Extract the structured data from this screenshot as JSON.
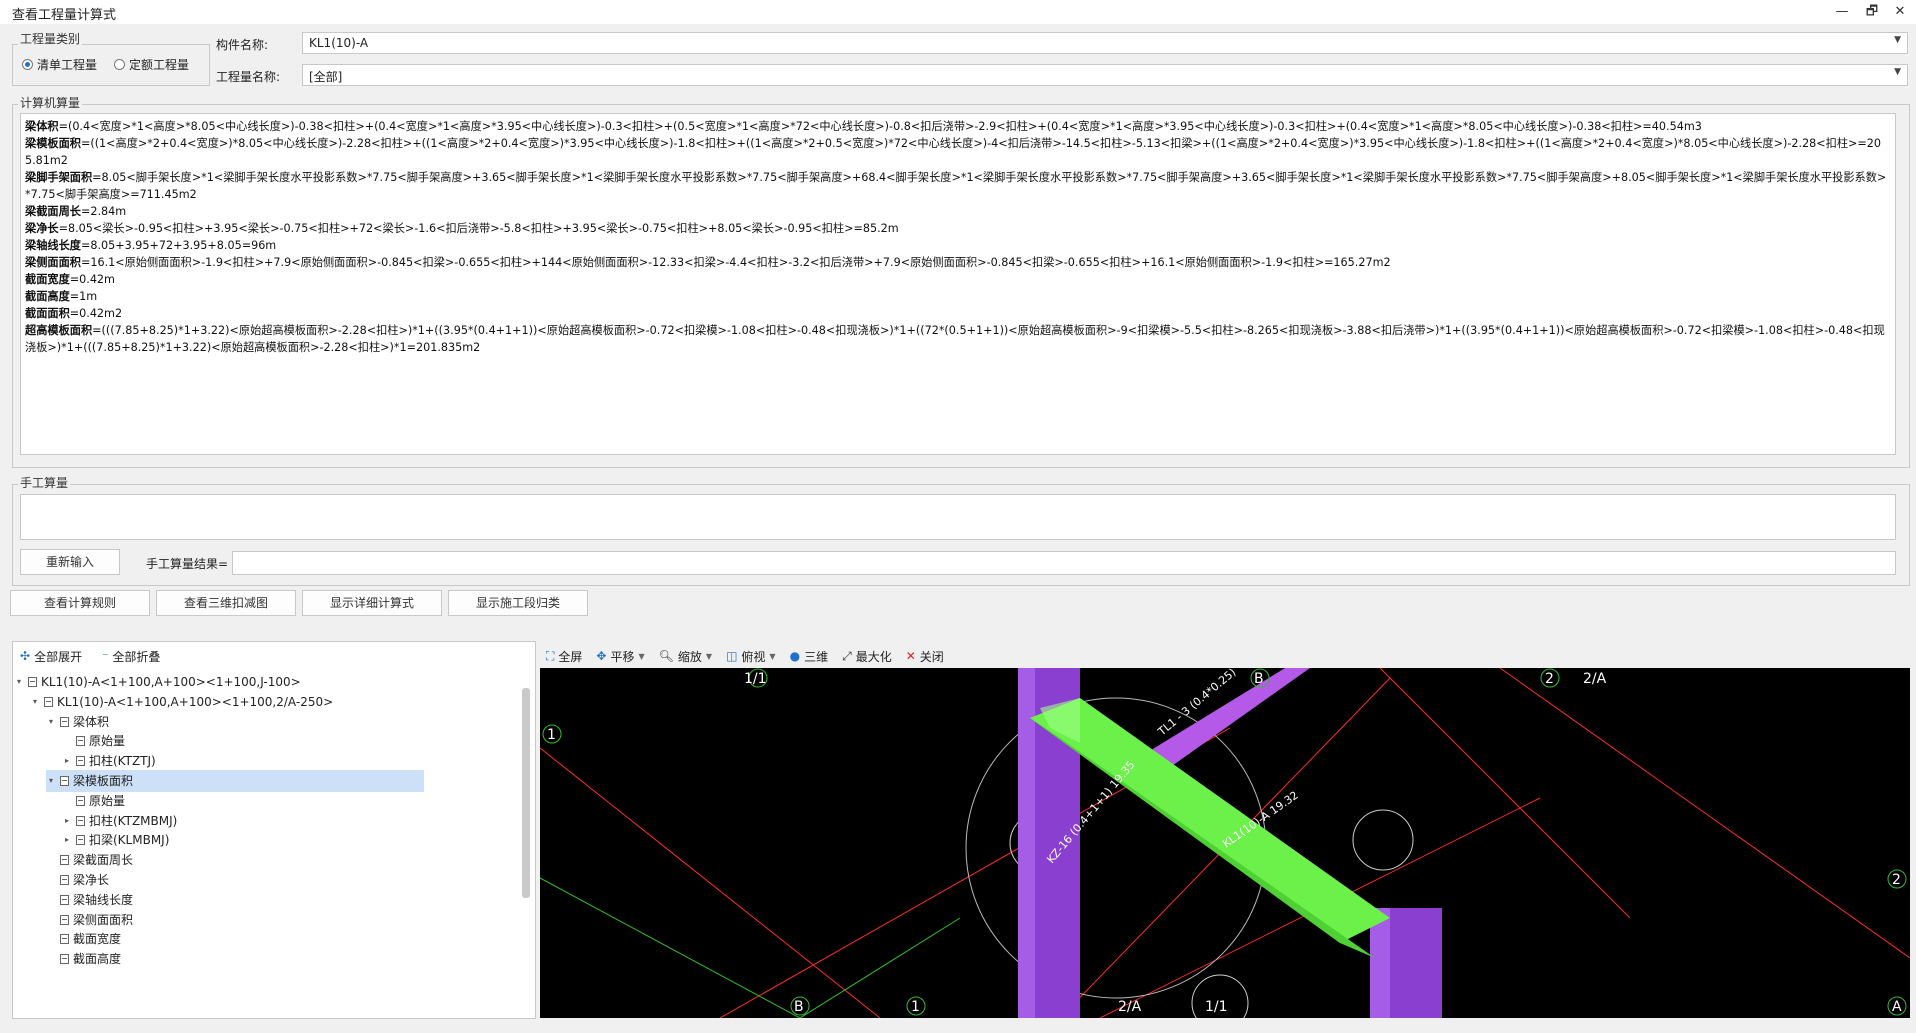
{
  "window": {
    "title": "查看工程量计算式",
    "minimize": "—",
    "restore": "🗗",
    "close": "✕"
  },
  "quantity_type": {
    "label": "工程量类别",
    "option1": "清单工程量",
    "option2": "定额工程量"
  },
  "component": {
    "label": "构件名称:",
    "value": "KL1(10)-A"
  },
  "quantity_name": {
    "label": "工程量名称:",
    "value": "[全部]"
  },
  "computer_calc": {
    "label": "计算机算量",
    "lines": [
      {
        "name": "梁体积",
        "formula": "=(0.4<宽度>*1<高度>*8.05<中心线长度>)-0.38<扣柱>+(0.4<宽度>*1<高度>*3.95<中心线长度>)-0.3<扣柱>+(0.5<宽度>*1<高度>*72<中心线长度>)-0.8<扣后浇带>-2.9<扣柱>+(0.4<宽度>*1<高度>*3.95<中心线长度>)-0.3<扣柱>+(0.4<宽度>*1<高度>*8.05<中心线长度>)-0.38<扣柱>=40.54m3"
      },
      {
        "name": "梁模板面积",
        "formula": "=((1<高度>*2+0.4<宽度>)*8.05<中心线长度>)-2.28<扣柱>+((1<高度>*2+0.4<宽度>)*3.95<中心线长度>)-1.8<扣柱>+((1<高度>*2+0.5<宽度>)*72<中心线长度>)-4<扣后浇带>-14.5<扣柱>-5.13<扣梁>+((1<高度>*2+0.4<宽度>)*3.95<中心线长度>)-1.8<扣柱>+((1<高度>*2+0.4<宽度>)*8.05<中心线长度>)-2.28<扣柱>=205.81m2"
      },
      {
        "name": "梁脚手架面积",
        "formula": "=8.05<脚手架长度>*1<梁脚手架长度水平投影系数>*7.75<脚手架高度>+3.65<脚手架长度>*1<梁脚手架长度水平投影系数>*7.75<脚手架高度>+68.4<脚手架长度>*1<梁脚手架长度水平投影系数>*7.75<脚手架高度>+3.65<脚手架长度>*1<梁脚手架长度水平投影系数>*7.75<脚手架高度>+8.05<脚手架长度>*1<梁脚手架长度水平投影系数>*7.75<脚手架高度>=711.45m2"
      },
      {
        "name": "梁截面周长",
        "formula": "=2.84m"
      },
      {
        "name": "梁净长",
        "formula": "=8.05<梁长>-0.95<扣柱>+3.95<梁长>-0.75<扣柱>+72<梁长>-1.6<扣后浇带>-5.8<扣柱>+3.95<梁长>-0.75<扣柱>+8.05<梁长>-0.95<扣柱>=85.2m"
      },
      {
        "name": "梁轴线长度",
        "formula": "=8.05+3.95+72+3.95+8.05=96m"
      },
      {
        "name": "梁侧面面积",
        "formula": "=16.1<原始侧面面积>-1.9<扣柱>+7.9<原始侧面面积>-0.845<扣梁>-0.655<扣柱>+144<原始侧面面积>-12.33<扣梁>-4.4<扣柱>-3.2<扣后浇带>+7.9<原始侧面面积>-0.845<扣梁>-0.655<扣柱>+16.1<原始侧面面积>-1.9<扣柱>=165.27m2"
      },
      {
        "name": "截面宽度",
        "formula": "=0.42m"
      },
      {
        "name": "截面高度",
        "formula": "=1m"
      },
      {
        "name": "截面面积",
        "formula": "=0.42m2"
      },
      {
        "name": "超高模板面积",
        "formula": "=(((7.85+8.25)*1+3.22)<原始超高模板面积>-2.28<扣柱>)*1+((3.95*(0.4+1+1))<原始超高模板面积>-0.72<扣梁模>-1.08<扣柱>-0.48<扣现浇板>)*1+((72*(0.5+1+1))<原始超高模板面积>-9<扣梁模>-5.5<扣柱>-8.265<扣现浇板>-3.88<扣后浇带>)*1+((3.95*(0.4+1+1))<原始超高模板面积>-0.72<扣梁模>-1.08<扣柱>-0.48<扣现浇板>)*1+(((7.85+8.25)*1+3.22)<原始超高模板面积>-2.28<扣柱>)*1=201.835m2"
      }
    ]
  },
  "manual_calc": {
    "label": "手工算量",
    "reenter_button": "重新输入",
    "result_label": "手工算量结果="
  },
  "actions": {
    "btn1": "查看计算规则",
    "btn2": "查看三维扣减图",
    "btn3": "显示详细计算式",
    "btn4": "显示施工段归类"
  },
  "tree_toolbar": {
    "expand_all": "全部展开",
    "collapse_all": "全部折叠"
  },
  "tree": [
    {
      "label": "KL1(10)-A<1+100,A+100><1+100,J-100>",
      "level": 0,
      "tri": "▾"
    },
    {
      "label": "KL1(10)-A<1+100,A+100><1+100,2/A-250>",
      "level": 1,
      "tri": "▾"
    },
    {
      "label": "梁体积",
      "level": 2,
      "tri": "▾"
    },
    {
      "label": "原始量",
      "level": 3,
      "tri": ""
    },
    {
      "label": "扣柱(KTZTJ)",
      "level": 3,
      "tri": "▸"
    },
    {
      "label": "梁模板面积",
      "level": 2,
      "tri": "▾",
      "selected": true
    },
    {
      "label": "原始量",
      "level": 3,
      "tri": ""
    },
    {
      "label": "扣柱(KTZMBMJ)",
      "level": 3,
      "tri": "▸"
    },
    {
      "label": "扣梁(KLMBMJ)",
      "level": 3,
      "tri": "▸"
    },
    {
      "label": "梁截面周长",
      "level": 2,
      "tri": ""
    },
    {
      "label": "梁净长",
      "level": 2,
      "tri": ""
    },
    {
      "label": "梁轴线长度",
      "level": 2,
      "tri": ""
    },
    {
      "label": "梁侧面面积",
      "level": 2,
      "tri": ""
    },
    {
      "label": "截面宽度",
      "level": 2,
      "tri": ""
    },
    {
      "label": "截面高度",
      "level": 2,
      "tri": ""
    }
  ],
  "view_toolbar": {
    "fullscreen": "全屏",
    "pan": "平移",
    "zoom": "缩放",
    "topview": "俯视",
    "view3d": "三维",
    "maximize": "最大化",
    "close": "关闭"
  },
  "view3d": {
    "axis_labels": [
      "1/1",
      "B",
      "2",
      "2/A",
      "1",
      "2",
      "B",
      "1",
      "2/A",
      "1/1",
      "A"
    ],
    "beam_label1": "TL1 - 3 (0.4*0.25)",
    "beam_label2": "KL1(10)-A 19.32",
    "column_label": "KZ-16 (0.4+1+1) 19.35"
  },
  "colors": {
    "green_beam": "#7fff5a",
    "purple_column": "#9b4fe0",
    "axis_red": "#ff2a2a",
    "axis_green": "#2fbf2f"
  }
}
